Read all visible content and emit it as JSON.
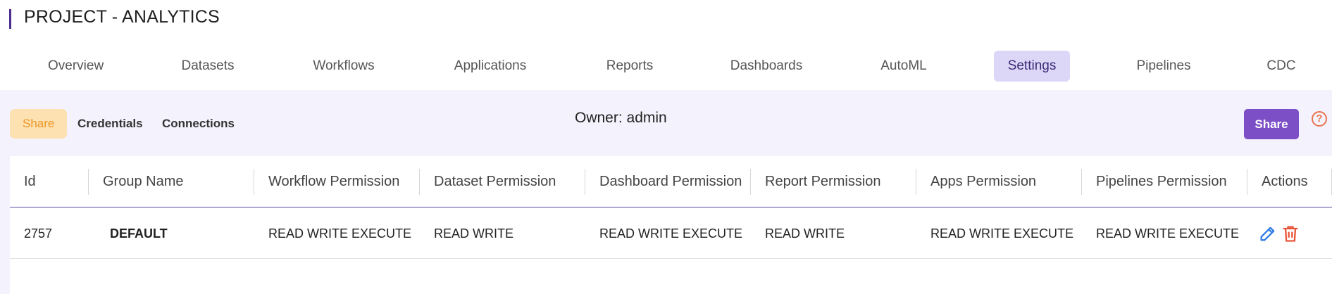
{
  "header": {
    "title": "PROJECT - ANALYTICS",
    "accent_color": "#4b2d8f"
  },
  "tabs": [
    {
      "label": "Overview"
    },
    {
      "label": "Datasets"
    },
    {
      "label": "Workflows"
    },
    {
      "label": "Applications"
    },
    {
      "label": "Reports"
    },
    {
      "label": "Dashboards"
    },
    {
      "label": "AutoML"
    },
    {
      "label": "Settings",
      "active": true
    },
    {
      "label": "Pipelines"
    },
    {
      "label": "CDC"
    }
  ],
  "subtabs": [
    {
      "label": "Share",
      "active": true
    },
    {
      "label": "Credentials"
    },
    {
      "label": "Connections"
    }
  ],
  "owner": "Owner: admin",
  "share_button": "Share",
  "help_icon": "help-circle-icon",
  "table": {
    "headers": [
      "Id",
      "Group Name",
      "Workflow Permission",
      "Dataset Permission",
      "Dashboard Permission",
      "Report Permission",
      "Apps Permission",
      "Pipelines Permission",
      "Actions"
    ],
    "rows": [
      {
        "id": "2757",
        "group_name": "DEFAULT",
        "workflow": "READ WRITE EXECUTE",
        "dataset": "READ WRITE",
        "dashboard": "READ WRITE EXECUTE",
        "report": "READ WRITE",
        "apps": "READ WRITE EXECUTE",
        "pipelines": "READ WRITE EXECUTE",
        "actions": [
          "edit-icon",
          "delete-icon"
        ]
      }
    ]
  },
  "colors": {
    "primary": "#7c4fc7",
    "active_tab_bg": "#dcd6f7",
    "subtab_active_bg": "#fde1b1",
    "subtab_active_text": "#ec9527",
    "edit": "#2f7be6",
    "delete": "#e8563a"
  }
}
